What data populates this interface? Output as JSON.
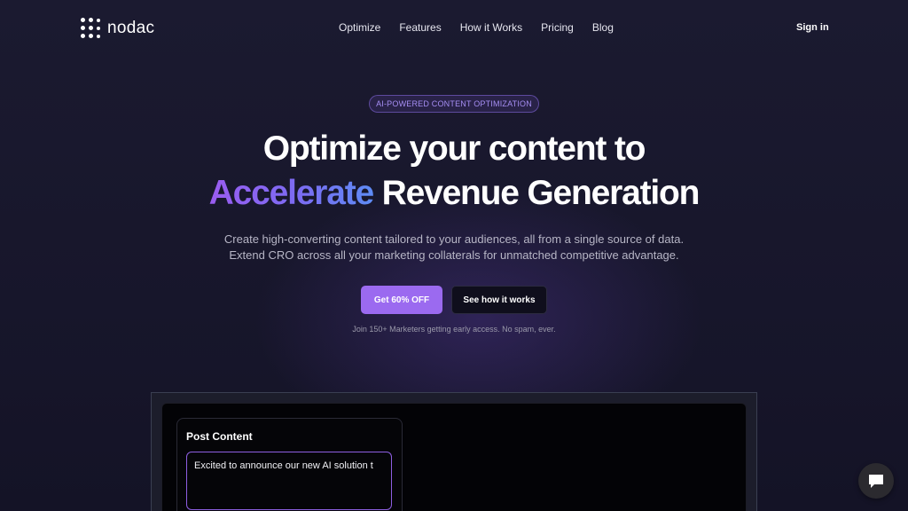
{
  "brand": {
    "name": "nodac"
  },
  "nav": {
    "links": [
      "Optimize",
      "Features",
      "How it Works",
      "Pricing",
      "Blog"
    ],
    "signin": "Sign in"
  },
  "hero": {
    "badge": "AI-POWERED CONTENT OPTIMIZATION",
    "title_line1": "Optimize your content to",
    "title_accent": "Accelerate",
    "title_line2_rest": " Revenue Generation",
    "subtitle_line1": "Create high-converting content tailored to your audiences, all from a single source of data.",
    "subtitle_line2": "Extend CRO across all your marketing collaterals for unmatched competitive advantage.",
    "cta_primary": "Get 60% OFF",
    "cta_secondary": "See how it works",
    "note": "Join 150+ Marketers getting early access. No spam, ever."
  },
  "preview": {
    "card_title": "Post Content",
    "input_value": "Excited to announce our new AI solution t"
  },
  "icons": {
    "logo": "dot-grid-icon",
    "chat": "chat-bubble-icon"
  },
  "colors": {
    "background": "#16152a",
    "accent_purple": "#9b6af0",
    "accent_gradient_start": "#9a5cf0",
    "accent_gradient_end": "#5e8cf5",
    "badge_text": "#a58ef3"
  }
}
